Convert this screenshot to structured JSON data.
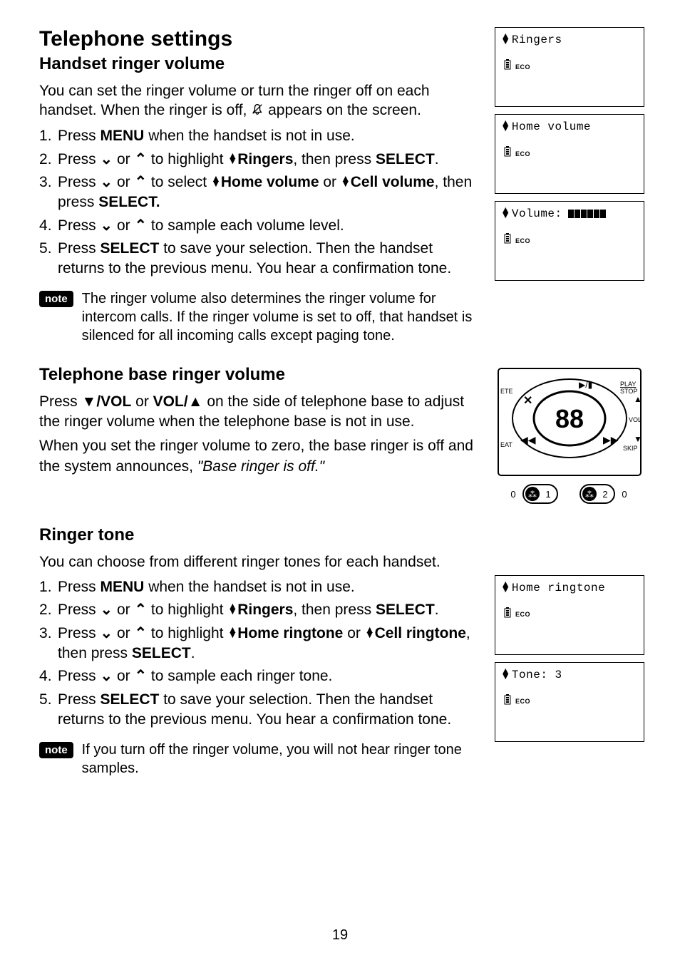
{
  "page_number": "19",
  "section1": {
    "heading": "Telephone settings",
    "subheading": "Handset ringer volume",
    "intro_a": "You can set the ringer volume or turn the ringer off on each handset. When the ringer is off, ",
    "intro_b": " appears on the screen.",
    "steps": {
      "s1_a": "Press ",
      "s1_b": "MENU",
      "s1_c": " when the handset is not in use.",
      "s2_a": "Press ",
      "s2_b": " or ",
      "s2_c": " to highlight ",
      "s2_d": "Ringers",
      "s2_e": ", then press ",
      "s2_f": "SELECT",
      "s2_g": ".",
      "s3_a": "Press ",
      "s3_b": " or ",
      "s3_c": " to select ",
      "s3_d": "Home volume",
      "s3_e": " or ",
      "s3_f": "Cell volume",
      "s3_g": ", then press ",
      "s3_h": "SELECT.",
      "s4_a": "Press ",
      "s4_b": " or ",
      "s4_c": " to sample each volume level.",
      "s5_a": "Press ",
      "s5_b": "SELECT",
      "s5_c": " to save your selection. Then the handset returns to the previous menu. You hear a confirmation tone."
    },
    "note_label": "note",
    "note_text": "The ringer volume also determines the ringer volume for intercom calls. If the ringer volume is set to off, that handset is silenced for all incoming calls except paging tone."
  },
  "section2": {
    "subheading": "Telephone base ringer volume",
    "p1_a": "Press ",
    "p1_b": "/VOL",
    "p1_c": " or ",
    "p1_d": "VOL/",
    "p1_e": " on the side of telephone base to adjust the ringer volume when the telephone base is not in use.",
    "p2_a": "When you set the ringer volume to zero, the base ringer is off and the system announces, ",
    "p2_b": "\"Base ringer is off.\""
  },
  "section3": {
    "subheading": "Ringer tone",
    "intro": "You can choose from different ringer tones for each handset.",
    "steps": {
      "s1_a": "Press ",
      "s1_b": "MENU",
      "s1_c": " when the handset is not in use.",
      "s2_a": "Press ",
      "s2_b": " or ",
      "s2_c": " to highlight ",
      "s2_d": "Ringers",
      "s2_e": ", then press ",
      "s2_f": "SELECT",
      "s2_g": ".",
      "s3_a": "Press ",
      "s3_b": " or ",
      "s3_c": " to highlight ",
      "s3_d": "Home ringtone",
      "s3_e": " or ",
      "s3_f": "Cell ringtone",
      "s3_g": ", then press ",
      "s3_h": "SELECT",
      "s3_i": ".",
      "s4_a": "Press ",
      "s4_b": " or ",
      "s4_c": " to sample each ringer tone.",
      "s5_a": "Press ",
      "s5_b": "SELECT",
      "s5_c": " to save your selection. Then the handset returns to the previous menu. You hear a confirmation tone."
    },
    "note_label": "note",
    "note_text": "If you turn off the ringer volume, you will not hear ringer tone samples."
  },
  "lcd": {
    "ringers": "Ringers",
    "home_volume": "Home volume",
    "volume_label": "Volume:",
    "home_ringtone": "Home ringtone",
    "tone": "Tone: 3",
    "eco": "ECO"
  },
  "base": {
    "labels": {
      "play_stop": "PLAY",
      "stop": "STOP",
      "vol": "VOL",
      "skip": "SKIP",
      "ete": "ETE",
      "eat": "EAT",
      "display": "88"
    }
  }
}
